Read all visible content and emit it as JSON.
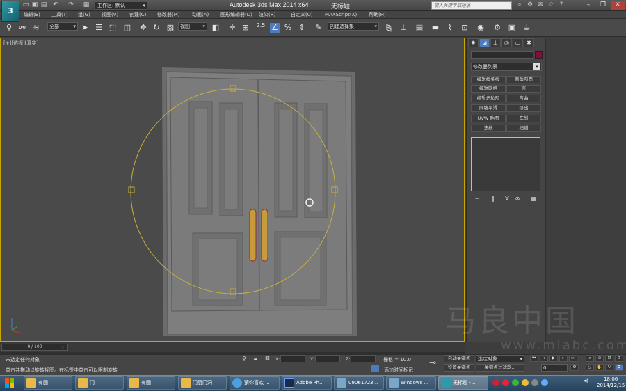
{
  "titlebar": {
    "workspace_label": "工作区: 默认",
    "app_title": "Autodesk 3ds Max  2014 x64",
    "doc_title": "无标题",
    "search_placeholder": "键入关键字或短语"
  },
  "menu": [
    "编辑(E)",
    "工具(T)",
    "组(G)",
    "视图(V)",
    "创建(C)",
    "修改器(M)",
    "动画(A)",
    "图形编辑器(D)",
    "渲染(R)",
    "自定义(U)",
    "MAXScript(X)",
    "帮助(H)"
  ],
  "toolbar": {
    "filter_select": "全部",
    "ref_coord_select": "视图",
    "named_sel_select": "创建选择集",
    "snap_label": "2.5"
  },
  "viewport": {
    "label": "[+][透视][真实]"
  },
  "command_panel": {
    "modifier_list": "修改器列表",
    "modifier_buttons": [
      [
        "编辑样条线",
        "倒角剖面"
      ],
      [
        "编辑网格",
        "壳"
      ],
      [
        "编辑多边形",
        "弯曲"
      ],
      [
        "网格平滑",
        "挤出"
      ],
      [
        "UVW 贴图",
        "车削"
      ],
      [
        "法线",
        "扫描"
      ]
    ]
  },
  "timeline": {
    "frame_range": "0 / 100"
  },
  "status": {
    "selection": "未选定任何对象",
    "prompt": "单击并拖动以旋转视图。在标签中单击可以限制旋转",
    "x_label": "X:",
    "y_label": "Y:",
    "z_label": "Z:",
    "grid": "栅格 = 10.0",
    "add_time_tag": "添加时间标记",
    "auto_key": "自动关键点",
    "set_key": "设置关键点",
    "selected_object": "选定对象",
    "key_filters": "关键点过滤器...",
    "frame_value": "0"
  },
  "taskbar": {
    "items": [
      "有图",
      "门",
      "有图",
      "门厨门洞",
      "猜你喜欢 ...",
      "Adobe Ph...",
      "09061723...",
      "Windows ...",
      "无标题 - ..."
    ],
    "time": "18:06",
    "date": "2014/12/15"
  },
  "watermark": {
    "main": "马良中国",
    "url": "www.mlabc.com"
  },
  "colors": {
    "selection_yellow": "#c8a500",
    "object_color": "#8b0a3e",
    "door_gray": "#7b7b7b",
    "handle_gold": "#c89a3a"
  }
}
